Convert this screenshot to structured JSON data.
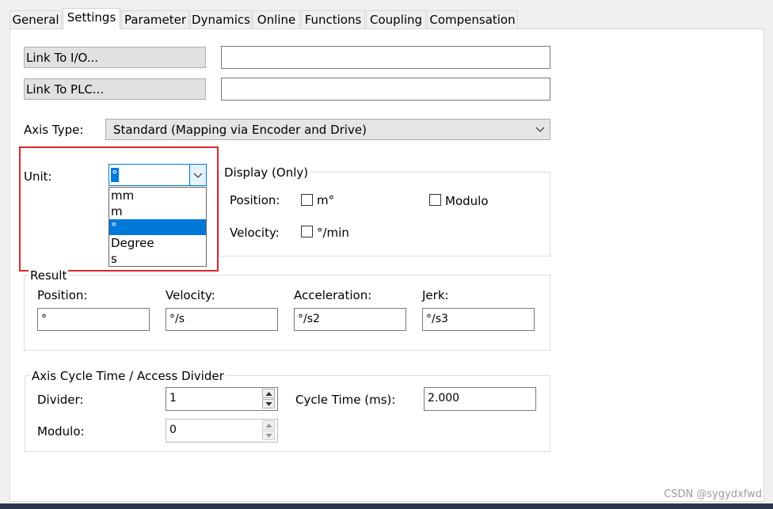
{
  "tabs": [
    "General",
    "Settings",
    "Parameter",
    "Dynamics",
    "Online",
    "Functions",
    "Coupling",
    "Compensation"
  ],
  "active_tab": "Settings",
  "link_io_label": "Link To I/O...",
  "link_io_value": "",
  "link_plc_label": "Link To PLC...",
  "link_plc_value": "",
  "axis_type_label": "Axis Type:",
  "axis_type_value": "Standard (Mapping via Encoder and Drive)",
  "unit_label": "Unit:",
  "unit_value": "°",
  "unit_options": [
    "mm",
    "m",
    "°",
    "Degree",
    "s"
  ],
  "unit_selected_index": 2,
  "display": {
    "title": "Display (Only)",
    "position_label": "Position:",
    "position_check_label": "m°",
    "modulo_check_label": "Modulo",
    "velocity_label": "Velocity:",
    "velocity_check_label": "°/min"
  },
  "result": {
    "title": "Result",
    "position_label": "Position:",
    "position_value": "°",
    "velocity_label": "Velocity:",
    "velocity_value": "°/s",
    "acceleration_label": "Acceleration:",
    "acceleration_value": "°/s2",
    "jerk_label": "Jerk:",
    "jerk_value": "°/s3"
  },
  "cycle": {
    "title": "Axis Cycle Time / Access Divider",
    "divider_label": "Divider:",
    "divider_value": "1",
    "cycle_time_label": "Cycle Time (ms):",
    "cycle_time_value": "2.000",
    "modulo_label": "Modulo:",
    "modulo_value": "0"
  },
  "watermark": "CSDN @sygydxfwd",
  "colors": {
    "highlight_box": "#d9262c",
    "selection": "#0078d7",
    "bottom_bar": "#2b3a4f"
  }
}
